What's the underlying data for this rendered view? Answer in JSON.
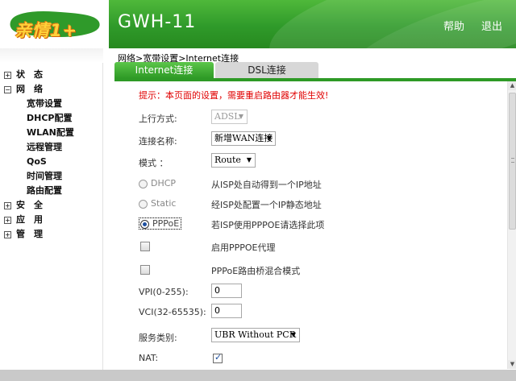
{
  "header": {
    "logo_text": "亲情1+",
    "title": "GWH-11",
    "help": "帮助",
    "exit": "退出"
  },
  "sidebar": {
    "sections": [
      {
        "label": "状　态",
        "expanded": false
      },
      {
        "label": "网　络",
        "expanded": true,
        "items": [
          "宽带设置",
          "DHCP配置",
          "WLAN配置",
          "远程管理",
          "QoS",
          "时间管理",
          "路由配置"
        ]
      },
      {
        "label": "安　全",
        "expanded": false
      },
      {
        "label": "应　用",
        "expanded": false
      },
      {
        "label": "管　理",
        "expanded": false
      }
    ]
  },
  "breadcrumb": "网络>宽带设置>Internet连接",
  "tabs": [
    {
      "label": "Internet连接",
      "active": true
    },
    {
      "label": "DSL连接",
      "active": false
    }
  ],
  "form": {
    "notice": "提示：本页面的设置，需要重启路由器才能生效!",
    "uplink_label": "上行方式:",
    "uplink_value": "ADSL",
    "conn_name_label": "连接名称:",
    "conn_name_value": "新增WAN连接",
    "mode_label": "模式 ：",
    "mode_value": "Route",
    "dhcp_label": "DHCP",
    "dhcp_desc": "从ISP处自动得到一个IP地址",
    "static_label": "Static",
    "static_desc": "经ISP处配置一个IP静态地址",
    "pppoe_label": "PPPoE",
    "pppoe_desc": "若ISP使用PPPOE请选择此项",
    "selected_mode": "PPPoE",
    "pppoe_proxy_label": "启用PPPOE代理",
    "pppoe_proxy_checked": false,
    "pppoe_bridge_label": "PPPoE路由桥混合模式",
    "pppoe_bridge_checked": false,
    "vpi_label": "VPI(0-255):",
    "vpi_value": "0",
    "vci_label": "VCI(32-65535):",
    "vci_value": "0",
    "service_label": "服务类别:",
    "service_value": "UBR Without PCR",
    "nat_label": "NAT:",
    "nat_checked": true
  },
  "colors": {
    "brand_green": "#2e9a26",
    "notice_red": "#e00000"
  }
}
